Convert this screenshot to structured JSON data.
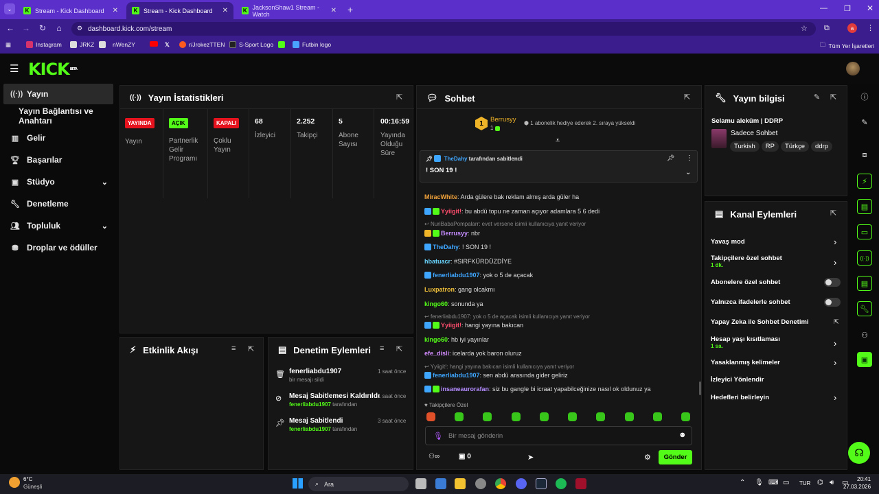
{
  "browser": {
    "tabs": [
      {
        "title": "Stream - Kick Dashboard"
      },
      {
        "title": "Stream - Kick Dashboard"
      },
      {
        "title": "JacksonShaw1 Stream - Watch"
      }
    ],
    "url": "dashboard.kick.com/stream",
    "profile_initial": "a",
    "bookmarks": [
      "Instagram",
      "JRKZ",
      "nWenZY",
      "r/JrokezTTEN",
      "S-Sport Logo",
      "Futbin logo"
    ],
    "all_bookmarks": "Tüm Yer İşaretleri"
  },
  "logo": {
    "text": "KICK",
    "sup": "BETA"
  },
  "sidebar": {
    "items": [
      {
        "label": "Yayın",
        "icon": "broadcast-icon"
      },
      {
        "label": "Yayın Bağlantısı ve Anahtarı",
        "icon": ""
      },
      {
        "label": "Gelir",
        "icon": "chart-icon"
      },
      {
        "label": "Başarılar",
        "icon": "trophy-icon"
      },
      {
        "label": "Stüdyo",
        "icon": "studio-icon"
      },
      {
        "label": "Denetleme",
        "icon": "wrench-icon"
      },
      {
        "label": "Topluluk",
        "icon": "people-icon"
      },
      {
        "label": "Droplar ve ödüller",
        "icon": "gift-icon"
      }
    ]
  },
  "stats": {
    "title": "Yayın İstatistikleri",
    "cols": [
      {
        "badge": "YAYINDA",
        "label": "Yayın",
        "color": "#e5131d"
      },
      {
        "badge": "AÇIK",
        "label": "Partnerlik Gelir Programı",
        "color": "#53fc18"
      },
      {
        "badge": "KAPALI",
        "label": "Çoklu Yayın",
        "color": "#e5131d"
      },
      {
        "value": "68",
        "label": "İzleyici"
      },
      {
        "value": "2.252",
        "label": "Takipçi"
      },
      {
        "value": "5",
        "label": "Abone Sayısı"
      },
      {
        "value": "00:16:59",
        "label": "Yayında Olduğu Süre"
      }
    ]
  },
  "activity": {
    "title": "Etkinlik Akışı"
  },
  "moderation": {
    "title": "Denetim Eylemleri",
    "items": [
      {
        "title": "fenerliabdu1907",
        "sub": "bir mesajı sildi",
        "time": "1 saat önce"
      },
      {
        "title": "Mesaj Sabitlemesi Kaldırıldı",
        "sub_user": "fenerliabdu1907",
        "sub": "tarafından",
        "time": "1 saat önce"
      },
      {
        "title": "Mesaj Sabitlendi",
        "sub_user": "fenerliabdu1907",
        "sub": "tarafından",
        "time": "3 saat önce"
      }
    ]
  },
  "chat": {
    "title": "Sohbet",
    "top_user": {
      "name": "Berrusyy",
      "rank": "1",
      "count": "1"
    },
    "gift_text": "1 abonelik hediye ederek 2. sıraya yükseldi",
    "pinned": {
      "by_user": "TheDahy",
      "by_text": "tarafından sabitlendi",
      "message": "! SON 19 !"
    },
    "messages": [
      {
        "user": "MiracWhite",
        "color": "#f2a33a",
        "text": ": Arda gülere bak reklam almış arda güler ha"
      },
      {
        "user": "Yyiigit!",
        "color": "#ff4d6d",
        "text": ": bu abdü topu ne zaman açıyor adamlara 5 6 dedi"
      },
      {
        "reply": "NuriBabaPompalarr: evet versene isimli kullanıcıya yanıt veriyor"
      },
      {
        "user": "Berrusyy",
        "color": "#c48cff",
        "text": ": nbr"
      },
      {
        "user": "TheDahy",
        "color": "#3ea6ff",
        "text": ": ! SON 19 !"
      },
      {
        "user": "hbatuacr",
        "color": "#6bd6ff",
        "text": ": #SIRFKÜRDÜZDİYE"
      },
      {
        "user": "fenerliabdu1907",
        "color": "#3ea6ff",
        "text": ": yok o 5 de açacak"
      },
      {
        "user": "Luxpatron",
        "color": "#f2c23a",
        "text": ": gang olcakmı"
      },
      {
        "user": "kingo60",
        "color": "#53fc18",
        "text": ": sonunda ya"
      },
      {
        "reply": "fenerliabdu1907: yok o 5 de açacak isimli kullanıcıya yanıt veriyor"
      },
      {
        "user": "Yyiigit!",
        "color": "#ff4d6d",
        "text": ": hangi yayına bakıcan"
      },
      {
        "user": "kingo60",
        "color": "#53fc18",
        "text": ": hb iyi yayınlar"
      },
      {
        "user": "efe_disli",
        "color": "#d38cff",
        "text": ": icelarda yok baron oluruz"
      },
      {
        "reply": "Yyiigit!: hangi yayına bakıcan isimli kullanıcıya yanıt veriyor"
      },
      {
        "user": "fenerliabdu1907",
        "color": "#3ea6ff",
        "text": ": sen abdü arasında gider geliriz"
      },
      {
        "user": "insaneaurorafan",
        "color": "#b48cff",
        "text": ": siz bu gangle bi icraat yapabilceğinize nasıl ok oldunuz ya"
      }
    ],
    "followers_only": "Takipçilere Özel",
    "input_placeholder": "Bir mesaj gönderin",
    "counter": "0",
    "send": "Gönder"
  },
  "info": {
    "title": "Yayın bilgisi",
    "stream_title": "Selamu aleküm | DDRP",
    "category": "Sadece Sohbet",
    "tags": [
      "Turkish",
      "RP",
      "Türkçe",
      "ddrp"
    ]
  },
  "channel": {
    "title": "Kanal Eylemleri",
    "rows": [
      {
        "label": "Yavaş mod",
        "sub": "",
        "ctrl": "chevron"
      },
      {
        "label": "Takipçilere özel sohbet",
        "sub": "1 dk.",
        "ctrl": "chevron"
      },
      {
        "label": "Abonelere özel sohbet",
        "sub": "",
        "ctrl": "toggle"
      },
      {
        "label": "Yalnızca ifadelerle sohbet",
        "sub": "",
        "ctrl": "toggle"
      },
      {
        "label": "Yapay Zeka ile Sohbet Denetimi",
        "sub": "",
        "ctrl": "external"
      },
      {
        "label": "Hesap yaşı kısıtlaması",
        "sub": "1 sa.",
        "ctrl": "chevron"
      },
      {
        "label": "Yasaklanmış kelimeler",
        "sub": "",
        "ctrl": "chevron"
      },
      {
        "label": "İzleyici Yönlendir",
        "sub": "",
        "ctrl": "none"
      },
      {
        "label": "Hedefleri belirleyin",
        "sub": "",
        "ctrl": "chevron"
      }
    ]
  },
  "taskbar": {
    "weather_temp": "6°C",
    "weather_text": "Güneşli",
    "search": "Ara",
    "lang": "TUR",
    "time": "20:41",
    "date": "27.03.2026"
  }
}
